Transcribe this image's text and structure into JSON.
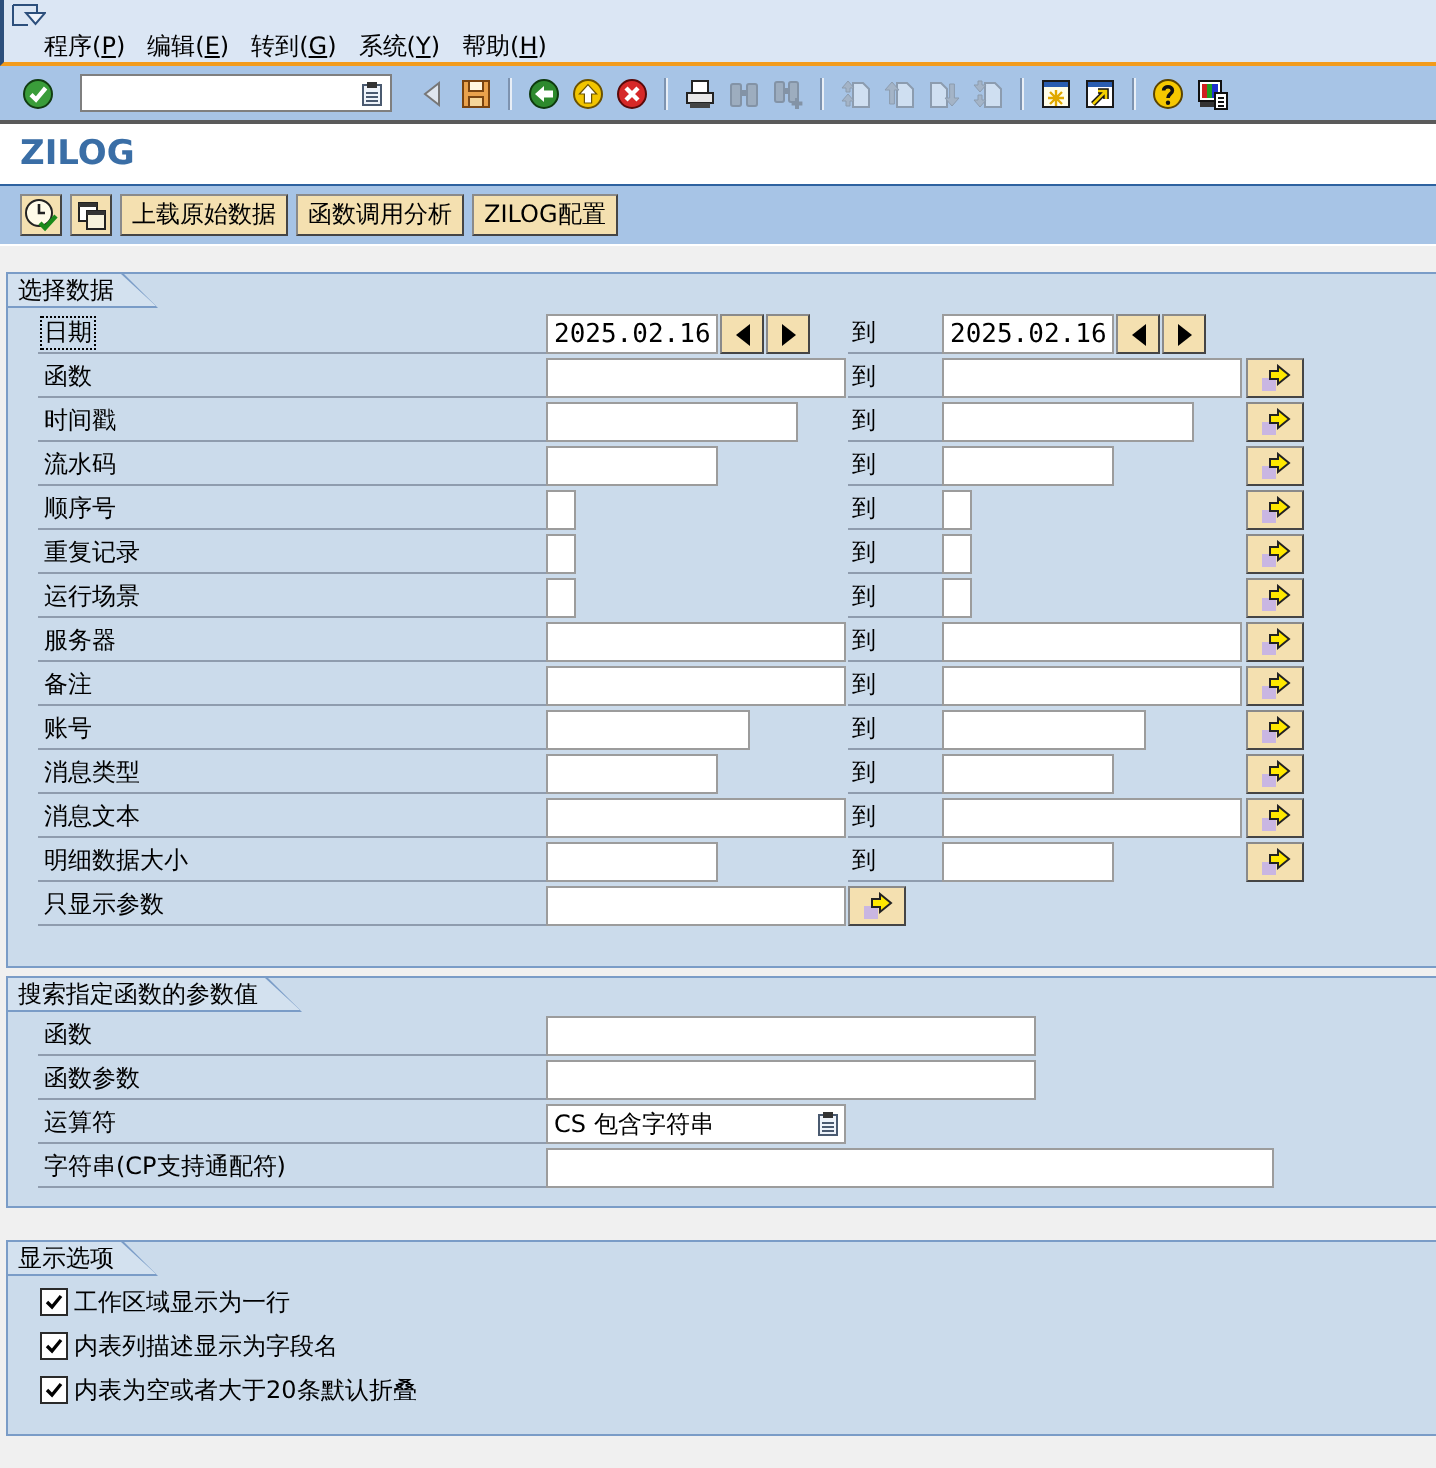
{
  "menu_bar": {
    "items": [
      {
        "text": "程序(",
        "key": "P",
        "tail": ")"
      },
      {
        "text": "编辑(",
        "key": "E",
        "tail": ")"
      },
      {
        "text": "转到(",
        "key": "G",
        "tail": ")"
      },
      {
        "text": "系统(",
        "key": "Y",
        "tail": ")"
      },
      {
        "text": "帮助(",
        "key": "H",
        "tail": ")"
      }
    ]
  },
  "system_toolbar": {
    "groups": [
      {
        "buttons": [
          {
            "kind": "enter",
            "disabled": false
          },
          {
            "kind": "command-field",
            "disabled": false
          },
          {
            "kind": "collapse",
            "disabled": false
          },
          {
            "kind": "save",
            "disabled": false
          }
        ]
      },
      {
        "buttons": [
          {
            "kind": "back",
            "disabled": false
          },
          {
            "kind": "exit",
            "disabled": false
          },
          {
            "kind": "cancel",
            "disabled": false
          }
        ]
      },
      {
        "buttons": [
          {
            "kind": "print",
            "disabled": false
          },
          {
            "kind": "find",
            "disabled": true
          },
          {
            "kind": "find-next",
            "disabled": true
          }
        ]
      },
      {
        "buttons": [
          {
            "kind": "first-page",
            "disabled": true
          },
          {
            "kind": "previous-page",
            "disabled": true
          },
          {
            "kind": "next-page",
            "disabled": true
          },
          {
            "kind": "last-page",
            "disabled": true
          }
        ]
      },
      {
        "buttons": [
          {
            "kind": "new-session",
            "disabled": false
          },
          {
            "kind": "shortcut",
            "disabled": false
          }
        ]
      },
      {
        "buttons": [
          {
            "kind": "help",
            "disabled": false
          },
          {
            "kind": "layout",
            "disabled": false
          }
        ]
      }
    ]
  },
  "title": "ZILOG",
  "application_toolbar": {
    "buttons": [
      {
        "kind": "clock"
      },
      {
        "kind": "windows"
      },
      {
        "kind": "text",
        "label": "上载原始数据"
      },
      {
        "kind": "text",
        "label": "函数调用分析"
      },
      {
        "kind": "text",
        "label": "ZILOG配置"
      }
    ]
  },
  "selection_block": {
    "title": "选择数据",
    "rows": [
      {
        "kind": "date-range",
        "label": "日期",
        "focused": true,
        "low": "2025.02.16",
        "to_label": "到",
        "high": "2025.02.16"
      },
      {
        "kind": "range",
        "label": "函数",
        "focused": false,
        "to_label": "到"
      },
      {
        "kind": "range",
        "label": "时间戳",
        "focused": false,
        "to_label": "到"
      },
      {
        "kind": "range",
        "label": "流水码",
        "focused": false,
        "to_label": "到"
      },
      {
        "kind": "range",
        "label": "顺序号",
        "focused": false,
        "to_label": "到"
      },
      {
        "kind": "range",
        "label": "重复记录",
        "focused": false,
        "to_label": "到"
      },
      {
        "kind": "range",
        "label": "运行场景",
        "focused": false,
        "to_label": "到"
      },
      {
        "kind": "range",
        "label": "服务器",
        "focused": false,
        "to_label": "到"
      },
      {
        "kind": "range",
        "label": "备注",
        "focused": false,
        "to_label": "到"
      },
      {
        "kind": "range",
        "label": "账号",
        "focused": false,
        "to_label": "到"
      },
      {
        "kind": "range",
        "label": "消息类型",
        "focused": false,
        "to_label": "到"
      },
      {
        "kind": "range",
        "label": "消息文本",
        "focused": false,
        "to_label": "到"
      },
      {
        "kind": "range",
        "label": "明细数据大小",
        "focused": false,
        "to_label": "到"
      },
      {
        "kind": "single",
        "label": "只显示参数",
        "focused": false
      }
    ]
  },
  "parameter_block": {
    "title": "搜索指定函数的参数值",
    "rows": [
      {
        "kind": "input",
        "label": "函数"
      },
      {
        "kind": "input",
        "label": "函数参数"
      },
      {
        "kind": "dropdown",
        "label": "运算符",
        "value": "CS 包含字符串"
      },
      {
        "kind": "input",
        "label": "字符串(CP支持通配符)"
      }
    ]
  },
  "display_block": {
    "title": "显示选项",
    "options": [
      {
        "label": "工作区域显示为一行",
        "checked": true
      },
      {
        "label": "内表列描述显示为字段名",
        "checked": true
      },
      {
        "label": "内表为空或者大于20条默认折叠",
        "checked": true
      }
    ]
  }
}
